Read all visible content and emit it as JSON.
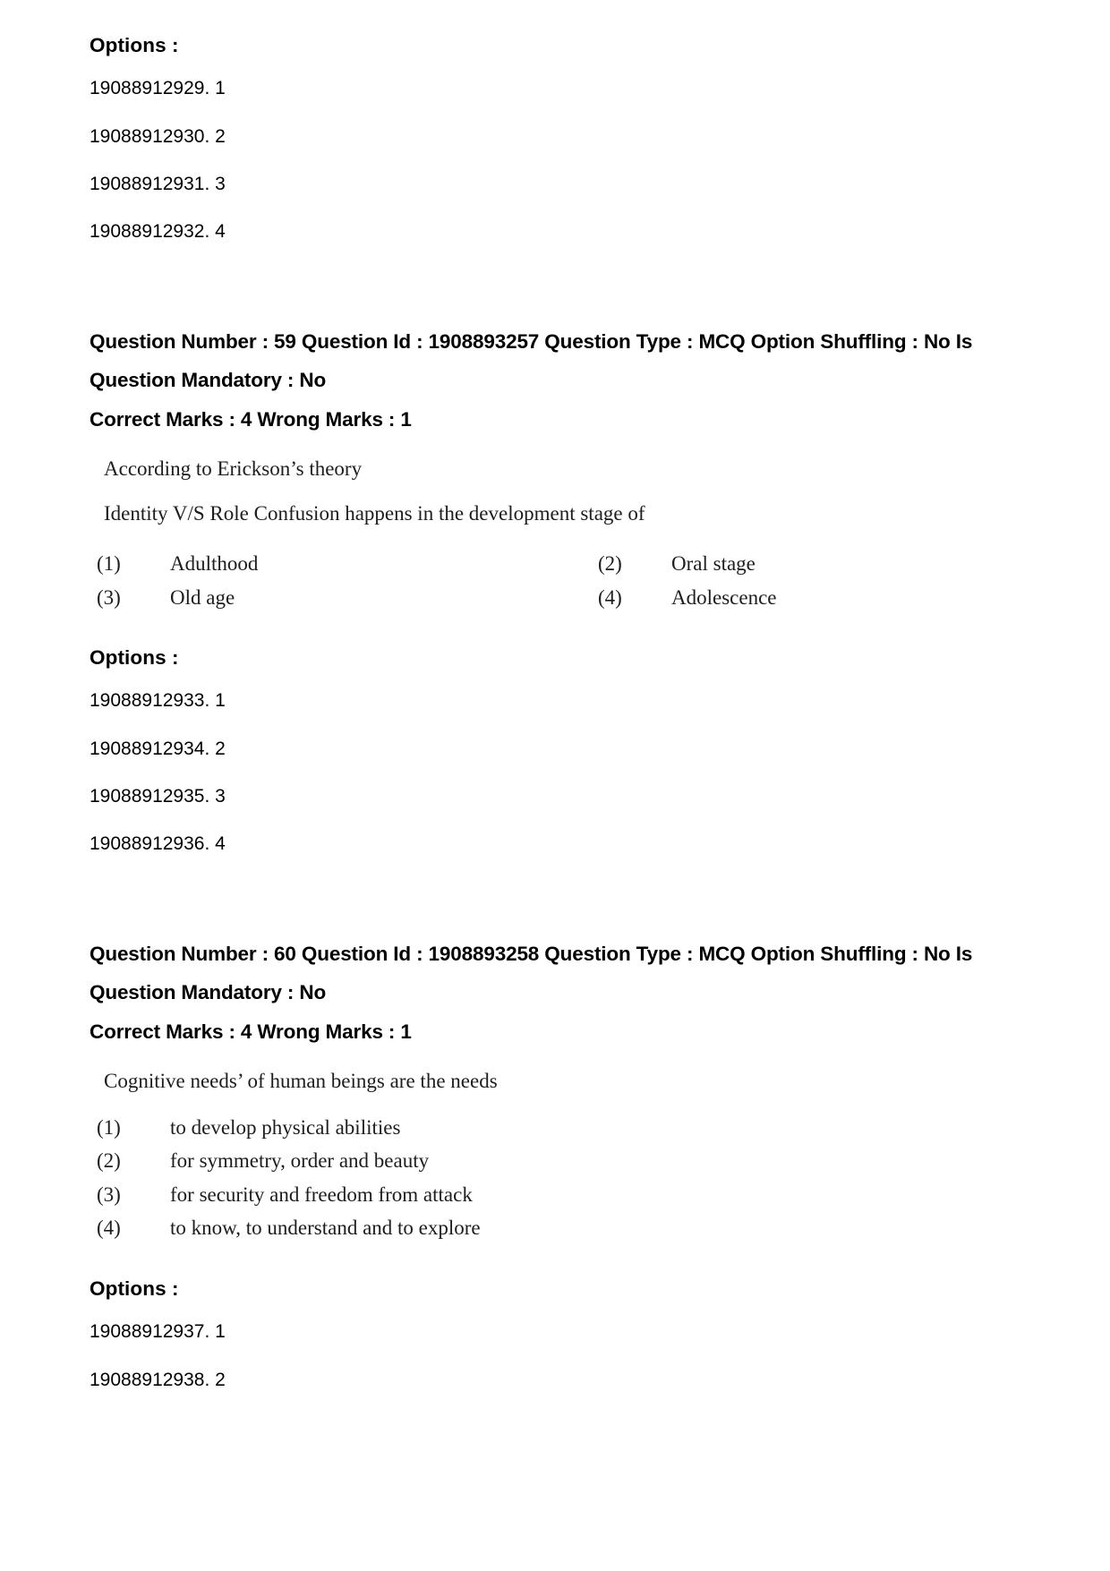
{
  "page": {
    "labels": {
      "options_heading": "Options :"
    }
  },
  "blocks": {
    "prev_question_options": {
      "heading": "Options :",
      "items": [
        "19088912929. 1",
        "19088912930. 2",
        "19088912931. 3",
        "19088912932. 4"
      ]
    },
    "question_59": {
      "header_line1": "Question Number : 59 Question Id : 1908893257 Question Type : MCQ Option Shuffling : No Is",
      "header_line2": "Question Mandatory : No",
      "marks_line": "Correct Marks : 4 Wrong Marks : 1",
      "stem_lines": [
        "According to Erickson’s theory",
        "Identity V/S Role Confusion happens in the development stage of"
      ],
      "choices": [
        {
          "num": "(1)",
          "text": "Adulthood"
        },
        {
          "num": "(2)",
          "text": "Oral stage"
        },
        {
          "num": "(3)",
          "text": "Old age"
        },
        {
          "num": "(4)",
          "text": "Adolescence"
        }
      ],
      "options_heading": "Options :",
      "option_ids": [
        "19088912933. 1",
        "19088912934. 2",
        "19088912935. 3",
        "19088912936. 4"
      ]
    },
    "question_60": {
      "header_line1": "Question Number : 60 Question Id : 1908893258 Question Type : MCQ Option Shuffling : No Is",
      "header_line2": "Question Mandatory : No",
      "marks_line": "Correct Marks : 4 Wrong Marks : 1",
      "stem_lines": [
        "Cognitive needs’ of human beings are the needs"
      ],
      "choices": [
        {
          "num": "(1)",
          "text": "to develop physical abilities"
        },
        {
          "num": "(2)",
          "text": "for symmetry, order and beauty"
        },
        {
          "num": "(3)",
          "text": "for security and freedom from attack"
        },
        {
          "num": "(4)",
          "text": "to know, to understand and to explore"
        }
      ],
      "options_heading": "Options :",
      "option_ids": [
        "19088912937. 1",
        "19088912938. 2"
      ]
    }
  }
}
